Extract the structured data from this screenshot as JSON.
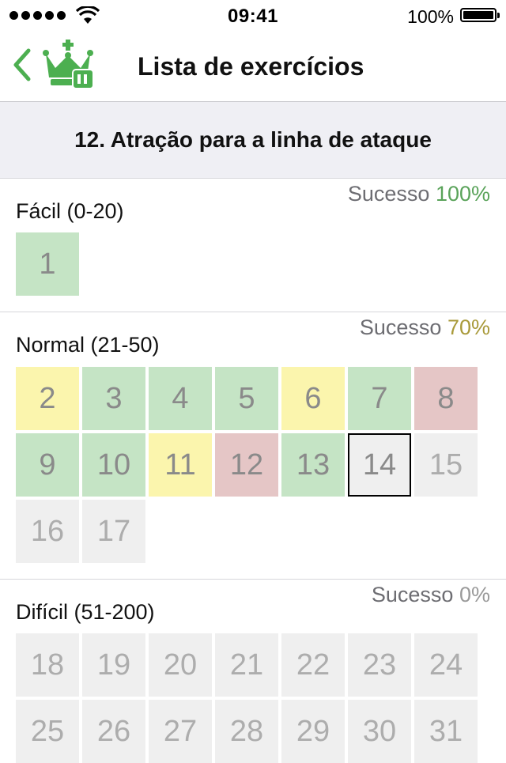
{
  "status": {
    "time": "09:41",
    "battery": "100%"
  },
  "nav": {
    "title": "Lista de exercícios"
  },
  "subheader": {
    "title": "12. Atração para a linha de ataque"
  },
  "colors": {
    "success_green": "#5aa35a",
    "success_olive": "#a99a3a",
    "success_gray": "#9a9a9a",
    "brand": "#4caf50"
  },
  "sections": [
    {
      "label": "Fácil (0-20)",
      "success_label": "Sucesso",
      "success_value": "100%",
      "items": [
        {
          "n": "1",
          "state": "green"
        }
      ]
    },
    {
      "label": "Normal (21-50)",
      "success_label": "Sucesso",
      "success_value": "70%",
      "items": [
        {
          "n": "2",
          "state": "yellow"
        },
        {
          "n": "3",
          "state": "green"
        },
        {
          "n": "4",
          "state": "green"
        },
        {
          "n": "5",
          "state": "green"
        },
        {
          "n": "6",
          "state": "yellow"
        },
        {
          "n": "7",
          "state": "green"
        },
        {
          "n": "8",
          "state": "red"
        },
        {
          "n": "9",
          "state": "green"
        },
        {
          "n": "10",
          "state": "green"
        },
        {
          "n": "11",
          "state": "yellow"
        },
        {
          "n": "12",
          "state": "red"
        },
        {
          "n": "13",
          "state": "green"
        },
        {
          "n": "14",
          "state": "selected"
        },
        {
          "n": "15",
          "state": "gray"
        },
        {
          "n": "16",
          "state": "gray"
        },
        {
          "n": "17",
          "state": "gray"
        }
      ]
    },
    {
      "label": "Difícil (51-200)",
      "success_label": "Sucesso",
      "success_value": "0%",
      "items": [
        {
          "n": "18",
          "state": "gray"
        },
        {
          "n": "19",
          "state": "gray"
        },
        {
          "n": "20",
          "state": "gray"
        },
        {
          "n": "21",
          "state": "gray"
        },
        {
          "n": "22",
          "state": "gray"
        },
        {
          "n": "23",
          "state": "gray"
        },
        {
          "n": "24",
          "state": "gray"
        },
        {
          "n": "25",
          "state": "gray"
        },
        {
          "n": "26",
          "state": "gray"
        },
        {
          "n": "27",
          "state": "gray"
        },
        {
          "n": "28",
          "state": "gray"
        },
        {
          "n": "29",
          "state": "gray"
        },
        {
          "n": "30",
          "state": "gray"
        },
        {
          "n": "31",
          "state": "gray"
        }
      ]
    }
  ]
}
